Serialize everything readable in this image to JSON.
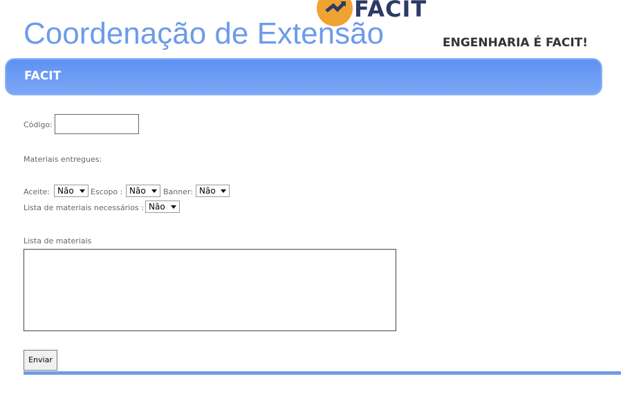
{
  "header": {
    "logo_text": "FACIT",
    "site_title": "Coordenação de Extensão",
    "slogan": "ENGENHARIA É FACIT!"
  },
  "nav": {
    "label": "FACIT"
  },
  "form": {
    "codigo_label": "Código:",
    "codigo_value": "",
    "materiais_label": "Materiais entregues:",
    "aceite_label": "Aceite:",
    "aceite_value": "Não",
    "escopo_label": "Escopo :",
    "escopo_value": "Não",
    "banner_label": "Banner:",
    "banner_value": "Não",
    "lista_necessarios_label": "Lista de materiais necessários :",
    "lista_necessarios_value": "Não",
    "lista_label": "Lista de materiais",
    "lista_value": "",
    "submit_label": "Enviar"
  },
  "colors": {
    "accent": "#6d9be9",
    "logo_orange": "#f0a232",
    "logo_navy": "#2d3a66"
  }
}
